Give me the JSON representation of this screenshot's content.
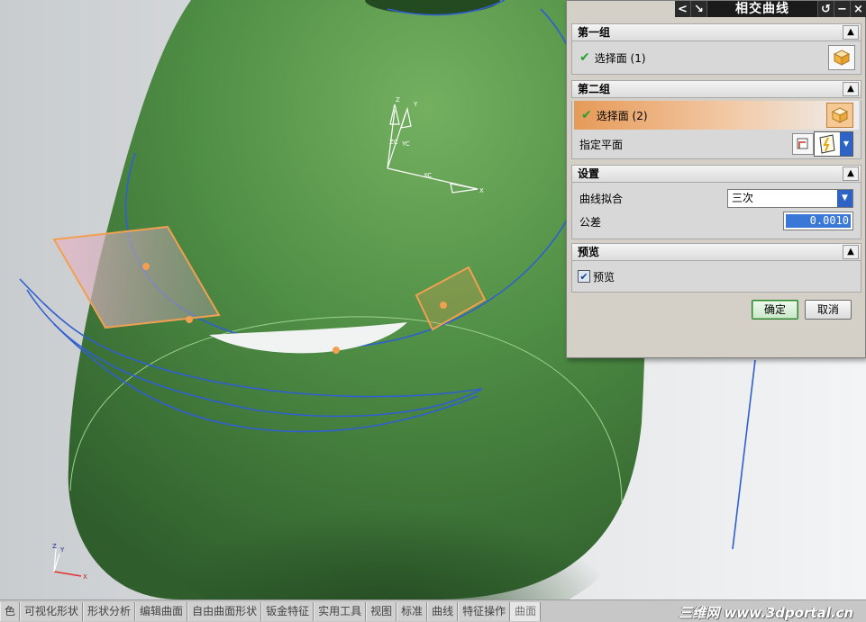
{
  "dialog": {
    "title": "相交曲线",
    "titlebar_buttons": [
      "<",
      "↘",
      "↺",
      "−",
      "×"
    ],
    "group1": {
      "header": "第一组",
      "select_face_label": "选择面 (1)"
    },
    "group2": {
      "header": "第二组",
      "select_face_label": "选择面 (2)",
      "plane_label": "指定平面"
    },
    "settings": {
      "header": "设置",
      "curve_fit_label": "曲线拟合",
      "curve_fit_value": "三次",
      "tolerance_label": "公差",
      "tolerance_value": "0.0010"
    },
    "preview": {
      "header": "预览",
      "checkbox_label": "预览",
      "checked": true
    },
    "ok_label": "确定",
    "cancel_label": "取消"
  },
  "viewport": {
    "csys_labels": {
      "z": "Z",
      "y": "Y",
      "zc": "ZC",
      "yc": "YC",
      "xc": "XC",
      "x": "X"
    },
    "mini_triad": {
      "z": "Z",
      "y": "Y",
      "x": "X"
    }
  },
  "taskbar": {
    "tabs": [
      "色",
      "可视化形状",
      "形状分析",
      "编辑曲面",
      "自由曲面形状",
      "钣金特征",
      "实用工具",
      "视图",
      "标准",
      "曲线",
      "特征操作",
      "曲面"
    ],
    "selected_tab": "曲面",
    "watermark": "三维网 www.3dportal.cn"
  },
  "colors": {
    "surface_green": "#4f8b44",
    "curve_blue": "#2f5fd0",
    "plane_orange": "#f0a050",
    "dialog_bg": "#d4d0c8"
  }
}
